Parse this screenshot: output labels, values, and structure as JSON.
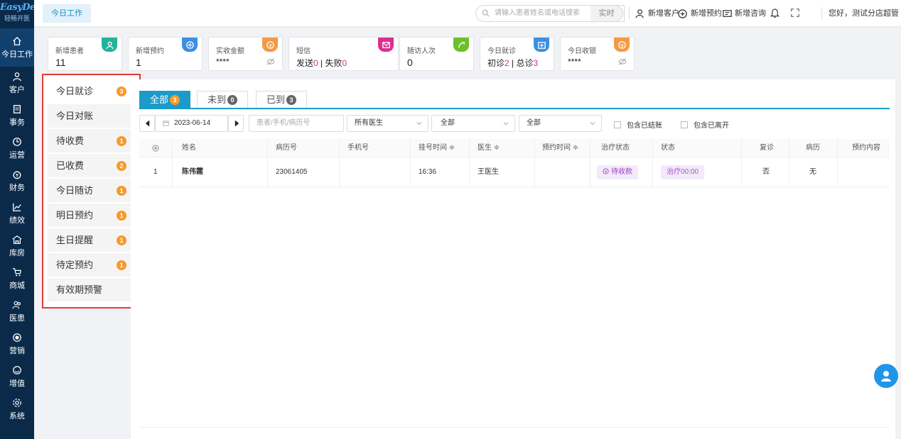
{
  "app": {
    "logo_main": "EasyDent",
    "logo_sub": "轻畅开医"
  },
  "nav": [
    {
      "label": "今日工作",
      "icon": "home-icon"
    },
    {
      "label": "客户",
      "icon": "user-icon"
    },
    {
      "label": "事务",
      "icon": "document-icon"
    },
    {
      "label": "运营",
      "icon": "clock-icon"
    },
    {
      "label": "财务",
      "icon": "money-icon"
    },
    {
      "label": "绩效",
      "icon": "chart-icon"
    },
    {
      "label": "库房",
      "icon": "warehouse-icon"
    },
    {
      "label": "商城",
      "icon": "cart-icon"
    },
    {
      "label": "医患",
      "icon": "people-icon"
    },
    {
      "label": "营销",
      "icon": "target-icon"
    },
    {
      "label": "增值",
      "icon": "value-icon"
    },
    {
      "label": "系统",
      "icon": "settings-icon"
    }
  ],
  "header": {
    "tab": "今日工作",
    "search_placeholder": "请输入患者姓名或电话搜索",
    "realtime": "实时",
    "new_customer": "新增客户",
    "new_appointment": "新增预约",
    "new_consult": "新增咨询",
    "greeting": "您好，测试分店超管"
  },
  "stats": [
    {
      "label": "新增患者",
      "value": "11",
      "color": "#23b39a"
    },
    {
      "label": "新增预约",
      "value": "1",
      "color": "#3d8fe0"
    },
    {
      "label": "实收金额",
      "value": "****",
      "color": "#f39a45"
    },
    {
      "label": "短信",
      "value_prefix": "发送",
      "v1": "0",
      "sep": " | 失败",
      "v2": "0",
      "color": "#d9308f"
    },
    {
      "label": "随访人次",
      "value": "0",
      "color": "#6cc02a"
    },
    {
      "label": "今日就诊",
      "value_prefix": "初诊",
      "v1": "2",
      "sep": " | 总诊",
      "v2": "3",
      "color": "#3d8fe0"
    },
    {
      "label": "今日收银",
      "value": "****",
      "color": "#f39a45"
    }
  ],
  "sidebar": [
    {
      "label": "今日就诊",
      "count": "3"
    },
    {
      "label": "今日对账",
      "count": ""
    },
    {
      "label": "待收费",
      "count": "1"
    },
    {
      "label": "已收费",
      "count": "2"
    },
    {
      "label": "今日随访",
      "count": "1"
    },
    {
      "label": "明日预约",
      "count": "1"
    },
    {
      "label": "生日提醒",
      "count": "1"
    },
    {
      "label": "待定预约",
      "count": "1"
    },
    {
      "label": "有效期预警",
      "count": ""
    }
  ],
  "tabs": [
    {
      "label": "全部",
      "count": "3"
    },
    {
      "label": "未到",
      "count": "0"
    },
    {
      "label": "已到",
      "count": "3"
    }
  ],
  "filters": {
    "date": "2023-06-14",
    "patient_placeholder": "患者/手机/病历号",
    "doctor": "所有医生",
    "status1": "全部",
    "status2": "全部",
    "include_settled": "包含已结账",
    "include_left": "包含已离开"
  },
  "table": {
    "headers": [
      "姓名",
      "病历号",
      "手机号",
      "挂号时间 ≑",
      "医生 ≑",
      "预约时间 ≑",
      "治疗状态",
      "状态",
      "复诊",
      "病历",
      "预约内容"
    ],
    "rows": [
      {
        "index": "1",
        "name": "陈伟霆",
        "record_no": "23061405",
        "phone": "",
        "reg_time": "16:36",
        "doctor": "王医生",
        "appt_time": "",
        "treat_status": "待收款",
        "status": "治疗00:00",
        "revisit": "否",
        "record": "无",
        "appt_content": ""
      }
    ]
  }
}
